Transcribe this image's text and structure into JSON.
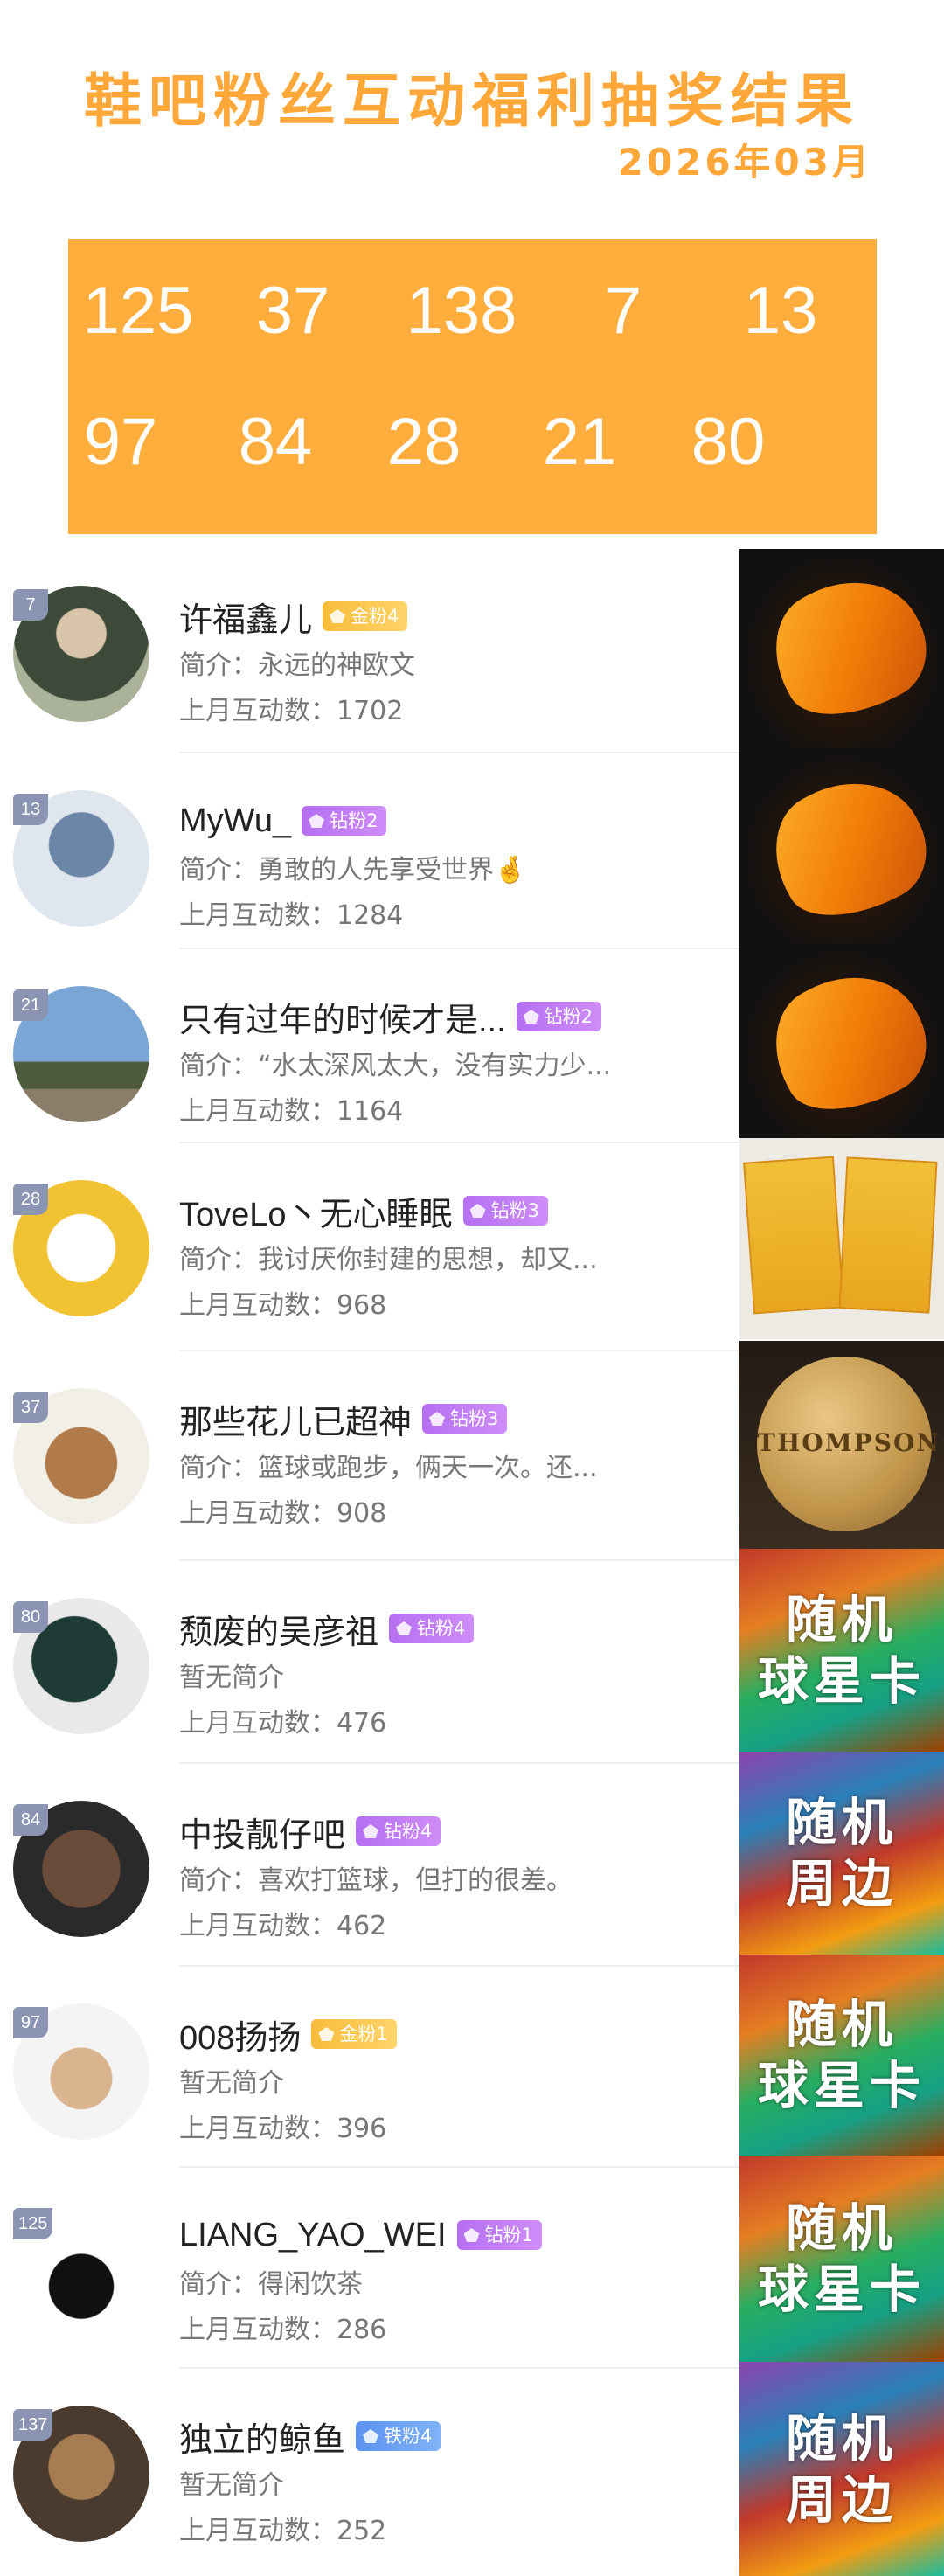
{
  "header": {
    "title": "鞋吧粉丝互动福利抽奖结果",
    "date": "2026年03月"
  },
  "numbers_row1": [
    "125",
    "37",
    "138",
    "7",
    "13"
  ],
  "numbers_row2": [
    "97",
    "84",
    "28",
    "21",
    "80"
  ],
  "winners": [
    {
      "no": "7",
      "name": "许福鑫儿",
      "tag": "金粉4",
      "tag_type": "gold",
      "intro": "简介：永远的神欧文",
      "count": "上月互动数：1702",
      "prize": "shoe"
    },
    {
      "no": "13",
      "name": "MyWu_",
      "tag": "钻粉2",
      "tag_type": "diamond",
      "intro": "简介：勇敢的人先享受世界🤞",
      "count": "上月互动数：1284",
      "prize": "shoe"
    },
    {
      "no": "21",
      "name": "只有过年的时候才是...",
      "tag": "钻粉2",
      "tag_type": "diamond",
      "intro": "简介：“水太深风太大，没有实力少...",
      "count": "上月互动数：1164",
      "prize": "shoe"
    },
    {
      "no": "28",
      "name": "ToveLo丶无心睡眠",
      "tag": "钻粉3",
      "tag_type": "diamond",
      "intro": "简介：我讨厌你封建的思想，却又...",
      "count": "上月互动数：968",
      "prize": "cards"
    },
    {
      "no": "37",
      "name": "那些花儿已超神",
      "tag": "钻粉3",
      "tag_type": "diamond",
      "intro": "简介：篮球或跑步，俩天一次。还...",
      "count": "上月互动数：908",
      "prize": "ball"
    },
    {
      "no": "80",
      "name": "颓废的吴彦祖",
      "tag": "钻粉4",
      "tag_type": "diamond",
      "intro": "暂无简介",
      "count": "上月互动数：476",
      "prize": "card_random"
    },
    {
      "no": "84",
      "name": "中投靓仔吧",
      "tag": "钻粉4",
      "tag_type": "diamond",
      "intro": "简介：喜欢打篮球，但打的很差。",
      "count": "上月互动数：462",
      "prize": "merch_random"
    },
    {
      "no": "97",
      "name": "008扬扬",
      "tag": "金粉1",
      "tag_type": "gold",
      "intro": "暂无简介",
      "count": "上月互动数：396",
      "prize": "card_random"
    },
    {
      "no": "125",
      "name": "LIANG_YAO_WEI",
      "tag": "钻粉1",
      "tag_type": "diamond",
      "intro": "简介：得闲饮茶",
      "count": "上月互动数：286",
      "prize": "card_random"
    },
    {
      "no": "137",
      "name": "独立的鲸鱼",
      "tag": "铁粉4",
      "tag_type": "iron",
      "intro": "暂无简介",
      "count": "上月互动数：252",
      "prize": "merch_random"
    }
  ],
  "prize_labels": {
    "card_random_line1": "随机",
    "card_random_line2": "球星卡",
    "merch_random_line1": "随机",
    "merch_random_line2": "周边",
    "ball_text": "THOMPSON"
  },
  "colors": {
    "accent": "#ffa739",
    "number_box": "#ffad3c"
  }
}
